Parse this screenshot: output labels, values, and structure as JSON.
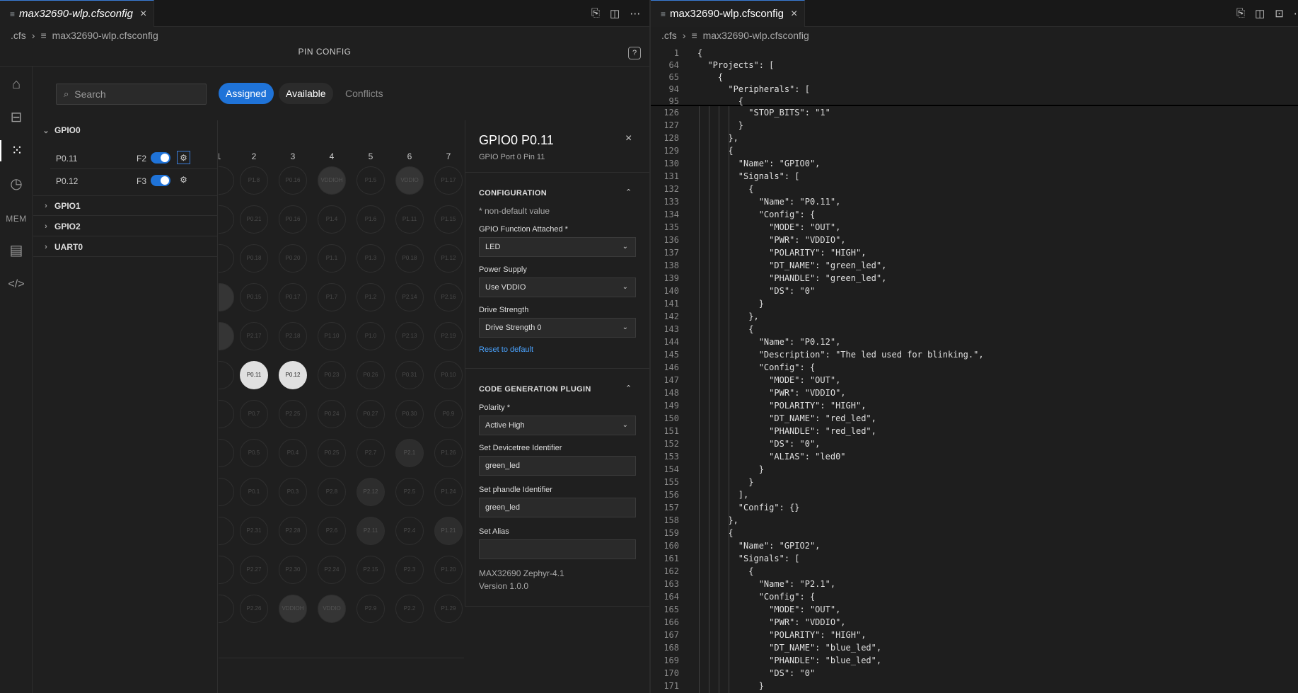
{
  "left": {
    "tab": {
      "title": "max32690-wlp.cfsconfig",
      "close": "×"
    },
    "breadcrumb": {
      "folder": ".cfs",
      "file": "max32690-wlp.cfsconfig"
    },
    "page_title": "PIN CONFIG",
    "help": "?",
    "activity": {
      "mem_label": "MEM"
    },
    "search_placeholder": "Search",
    "filters": {
      "assigned": "Assigned",
      "available": "Available",
      "conflicts": "Conflicts"
    },
    "tree": {
      "gpio0": "GPIO0",
      "pins": [
        {
          "name": "P0.11",
          "func": "F2"
        },
        {
          "name": "P0.12",
          "func": "F3"
        }
      ],
      "gpio1": "GPIO1",
      "gpio2": "GPIO2",
      "uart0": "UART0"
    },
    "grid": {
      "col_headers": [
        "1",
        "2",
        "3",
        "4",
        "5",
        "6",
        "7"
      ],
      "rows": [
        [
          "",
          "P1.8",
          "P0.16",
          "VDDIOH",
          "P1.5",
          "VDDIO",
          "P1.17"
        ],
        [
          "",
          "P0.21",
          "P0.16",
          "P1.4",
          "P1.6",
          "P1.11",
          "P1.15"
        ],
        [
          "",
          "P0.18",
          "P0.20",
          "P1.1",
          "P1.3",
          "P0.18",
          "P1.12"
        ],
        [
          "",
          "P0.15",
          "P0.17",
          "P1.7",
          "P1.2",
          "P2.14",
          "P2.16"
        ],
        [
          "",
          "P2.17",
          "P2.18",
          "P1.10",
          "P1.0",
          "P2.13",
          "P2.19"
        ],
        [
          "",
          "P0.11",
          "P0.12",
          "P0.23",
          "P0.26",
          "P0.31",
          "P0.10"
        ],
        [
          "",
          "P0.7",
          "P2.25",
          "P0.24",
          "P0.27",
          "P0.30",
          "P0.9"
        ],
        [
          "",
          "P0.5",
          "P0.4",
          "P0.25",
          "P2.7",
          "P2.1",
          "P1.26"
        ],
        [
          "",
          "P0.1",
          "P0.3",
          "P2.8",
          "P2.12",
          "P2.5",
          "P1.24"
        ],
        [
          "",
          "P2.31",
          "P2.28",
          "P2.6",
          "P2.11",
          "P2.4",
          "P1.21"
        ],
        [
          "",
          "P2.27",
          "P2.30",
          "P2.24",
          "P2.15",
          "P2.3",
          "P1.20"
        ],
        [
          "",
          "P2.26",
          "VDDIOH",
          "VDDIO",
          "P2.9",
          "P2.2",
          "P1.29"
        ]
      ]
    },
    "detail": {
      "title": "GPIO0 P0.11",
      "subtitle": "GPIO Port 0 Pin 11",
      "close": "×",
      "configuration": "CONFIGURATION",
      "note": "* non-default value",
      "func_label": "GPIO Function Attached *",
      "func_value": "LED",
      "power_label": "Power Supply",
      "power_value": "Use VDDIO",
      "drive_label": "Drive Strength",
      "drive_value": "Drive Strength 0",
      "reset": "Reset to default",
      "codegen": "CODE GENERATION PLUGIN",
      "polarity_label": "Polarity *",
      "polarity_value": "Active High",
      "dt_label": "Set Devicetree Identifier",
      "dt_value": "green_led",
      "phandle_label": "Set phandle Identifier",
      "phandle_value": "green_led",
      "alias_label": "Set Alias",
      "alias_value": "",
      "footer1": "MAX32690 Zephyr-4.1",
      "footer2": "Version 1.0.0"
    }
  },
  "right": {
    "tab": {
      "title": "max32690-wlp.cfsconfig",
      "close": "×"
    },
    "breadcrumb": {
      "folder": ".cfs",
      "file": "max32690-wlp.cfsconfig"
    },
    "sticky": [
      {
        "n": "1",
        "t": "{"
      },
      {
        "n": "64",
        "t": "  \"Projects\": ["
      },
      {
        "n": "65",
        "t": "    {"
      },
      {
        "n": "94",
        "t": "      \"Peripherals\": ["
      },
      {
        "n": "95",
        "t": "        {"
      }
    ],
    "lines": [
      {
        "n": "126",
        "t": "          \"STOP_BITS\": \"1\""
      },
      {
        "n": "127",
        "t": "        }"
      },
      {
        "n": "128",
        "t": "      },"
      },
      {
        "n": "129",
        "t": "      {"
      },
      {
        "n": "130",
        "t": "        \"Name\": \"GPIO0\","
      },
      {
        "n": "131",
        "t": "        \"Signals\": ["
      },
      {
        "n": "132",
        "t": "          {"
      },
      {
        "n": "133",
        "t": "            \"Name\": \"P0.11\","
      },
      {
        "n": "134",
        "t": "            \"Config\": {"
      },
      {
        "n": "135",
        "t": "              \"MODE\": \"OUT\","
      },
      {
        "n": "136",
        "t": "              \"PWR\": \"VDDIO\","
      },
      {
        "n": "137",
        "t": "              \"POLARITY\": \"HIGH\","
      },
      {
        "n": "138",
        "t": "              \"DT_NAME\": \"green_led\","
      },
      {
        "n": "139",
        "t": "              \"PHANDLE\": \"green_led\","
      },
      {
        "n": "140",
        "t": "              \"DS\": \"0\""
      },
      {
        "n": "141",
        "t": "            }"
      },
      {
        "n": "142",
        "t": "          },"
      },
      {
        "n": "143",
        "t": "          {"
      },
      {
        "n": "144",
        "t": "            \"Name\": \"P0.12\","
      },
      {
        "n": "145",
        "t": "            \"Description\": \"The led used for blinking.\","
      },
      {
        "n": "146",
        "t": "            \"Config\": {"
      },
      {
        "n": "147",
        "t": "              \"MODE\": \"OUT\","
      },
      {
        "n": "148",
        "t": "              \"PWR\": \"VDDIO\","
      },
      {
        "n": "149",
        "t": "              \"POLARITY\": \"HIGH\","
      },
      {
        "n": "150",
        "t": "              \"DT_NAME\": \"red_led\","
      },
      {
        "n": "151",
        "t": "              \"PHANDLE\": \"red_led\","
      },
      {
        "n": "152",
        "t": "              \"DS\": \"0\","
      },
      {
        "n": "153",
        "t": "              \"ALIAS\": \"led0\""
      },
      {
        "n": "154",
        "t": "            }"
      },
      {
        "n": "155",
        "t": "          }"
      },
      {
        "n": "156",
        "t": "        ],"
      },
      {
        "n": "157",
        "t": "        \"Config\": {}"
      },
      {
        "n": "158",
        "t": "      },"
      },
      {
        "n": "159",
        "t": "      {"
      },
      {
        "n": "160",
        "t": "        \"Name\": \"GPIO2\","
      },
      {
        "n": "161",
        "t": "        \"Signals\": ["
      },
      {
        "n": "162",
        "t": "          {"
      },
      {
        "n": "163",
        "t": "            \"Name\": \"P2.1\","
      },
      {
        "n": "164",
        "t": "            \"Config\": {"
      },
      {
        "n": "165",
        "t": "              \"MODE\": \"OUT\","
      },
      {
        "n": "166",
        "t": "              \"PWR\": \"VDDIO\","
      },
      {
        "n": "167",
        "t": "              \"POLARITY\": \"HIGH\","
      },
      {
        "n": "168",
        "t": "              \"DT_NAME\": \"blue_led\","
      },
      {
        "n": "169",
        "t": "              \"PHANDLE\": \"blue_led\","
      },
      {
        "n": "170",
        "t": "              \"DS\": \"0\""
      },
      {
        "n": "171",
        "t": "            }"
      }
    ]
  }
}
